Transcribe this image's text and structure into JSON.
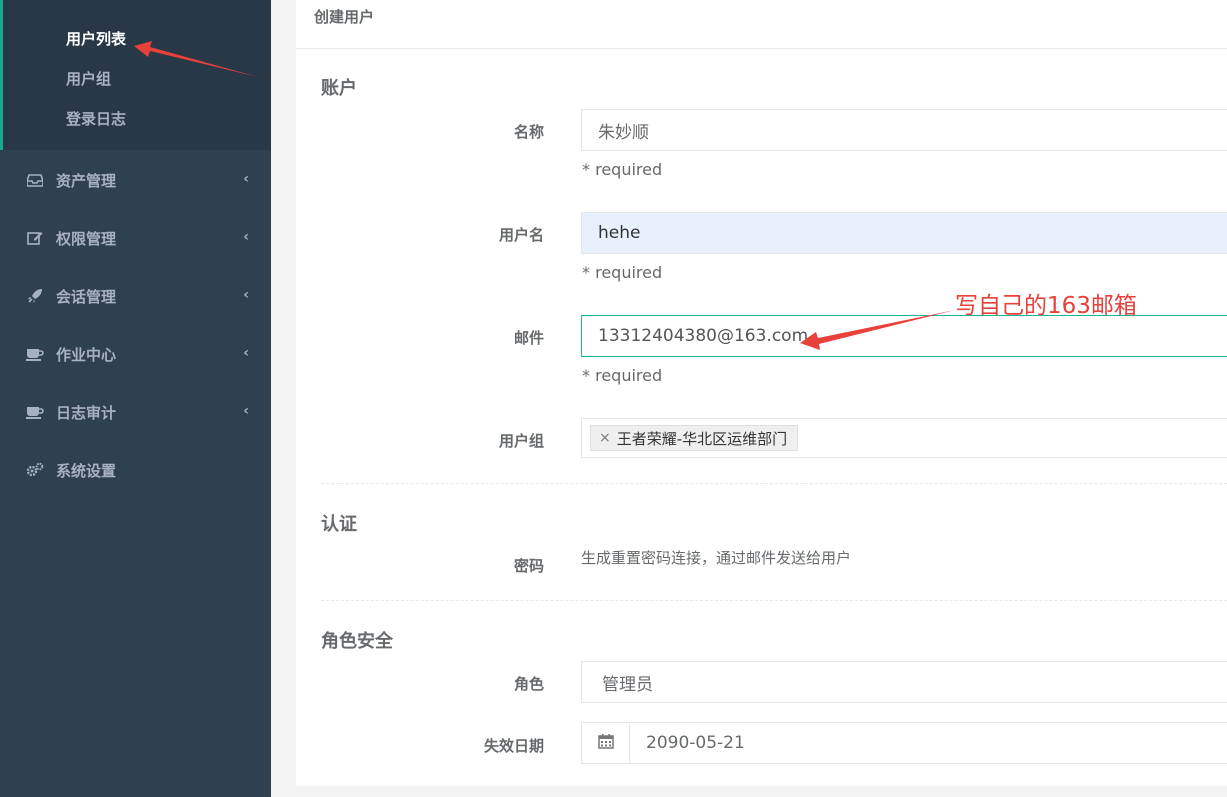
{
  "sidebar": {
    "sub_items": [
      {
        "label": "用户列表",
        "active": true
      },
      {
        "label": "用户组",
        "active": false
      },
      {
        "label": "登录日志",
        "active": false
      }
    ],
    "items": [
      {
        "label": "资产管理",
        "icon": "inbox-icon"
      },
      {
        "label": "权限管理",
        "icon": "edit-icon"
      },
      {
        "label": "会话管理",
        "icon": "rocket-icon"
      },
      {
        "label": "作业中心",
        "icon": "coffee-icon"
      },
      {
        "label": "日志审计",
        "icon": "coffee-icon"
      },
      {
        "label": "系统设置",
        "icon": "gears-icon"
      }
    ],
    "chevron": "‹"
  },
  "panel": {
    "title": "创建用户"
  },
  "sections": {
    "account": "账户",
    "auth": "认证",
    "role_security": "角色安全"
  },
  "form": {
    "name": {
      "label": "名称",
      "value": "朱妙顺",
      "hint": "* required"
    },
    "username": {
      "label": "用户名",
      "value": "hehe",
      "hint": "* required"
    },
    "email": {
      "label": "邮件",
      "value": "13312404380@163.com",
      "hint": "* required"
    },
    "group": {
      "label": "用户组",
      "tag": "王者荣耀-华北区运维部门",
      "tag_remove": "×"
    },
    "password": {
      "label": "密码",
      "text": "生成重置密码连接，通过邮件发送给用户"
    },
    "role": {
      "label": "角色",
      "value": "管理员"
    },
    "expire": {
      "label": "失效日期",
      "value": "2090-05-21"
    }
  },
  "annotation": {
    "text": "写自己的163邮箱",
    "color": "#e8403a"
  },
  "colors": {
    "sidebar_bg": "#2f4050",
    "submenu_bg": "#293846",
    "accent": "#1ab394"
  }
}
